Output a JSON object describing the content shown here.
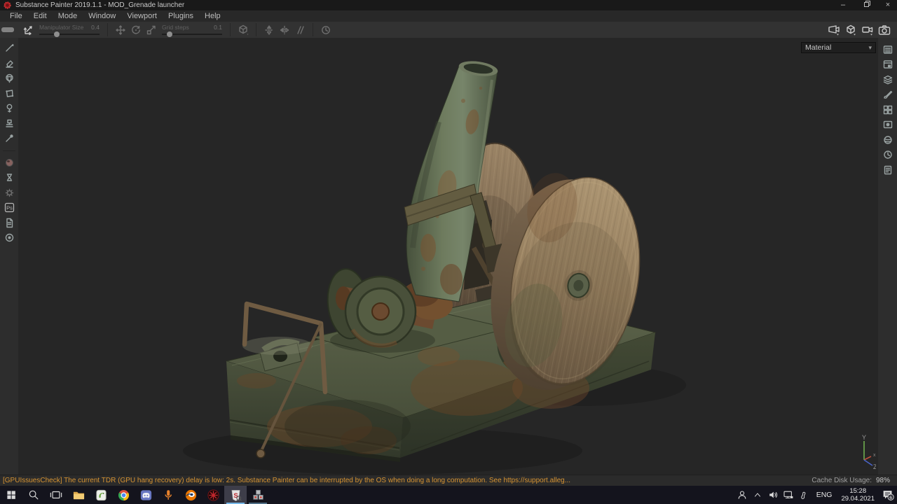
{
  "window": {
    "title": "Substance Painter 2019.1.1 - MOD_Grenade launcher",
    "controls": {
      "minimize": "–",
      "close": "×"
    }
  },
  "menu": {
    "items": [
      "File",
      "Edit",
      "Mode",
      "Window",
      "Viewport",
      "Plugins",
      "Help"
    ]
  },
  "toolbar": {
    "manipulator_label": "Manipulator Size",
    "manipulator_value": "0.4",
    "grid_label": "Grid steps",
    "grid_value": "0.1"
  },
  "viewport": {
    "shading_dropdown": "Material",
    "gizmo": {
      "y": "Y",
      "x": "x",
      "z": "Z"
    },
    "model_subject": "rusty green trench mortar with wooden wheels"
  },
  "left_toolbar": {
    "tools": [
      "paint",
      "eraser",
      "projection",
      "polygon-fill",
      "smudge",
      "clone",
      "material-picker"
    ],
    "plugins": [
      "sphere-plugin",
      "hourglass-plugin",
      "gear-plugin",
      "photoshop-export",
      "document-plugin",
      "circle-plugin"
    ]
  },
  "right_dock": {
    "panels": [
      "texture-set-list",
      "texture-set-settings",
      "layers",
      "properties",
      "shelf",
      "display-settings",
      "shader-settings",
      "history",
      "log"
    ]
  },
  "icons": {
    "chevron_down": "▾",
    "ps_badge": "Ps",
    "sp_letter": "S"
  },
  "status_bar": {
    "message": "[GPUIssuesCheck] The current TDR (GPU hang recovery) delay is low: 2s. Substance Painter can be interrupted by the OS when doing a long computation. See https://support.alleg...",
    "cache_label": "Cache Disk Usage:",
    "cache_value": "98%"
  },
  "taskbar": {
    "apps": [
      "start",
      "search",
      "task-view",
      "file-explorer",
      "notepad-plus-plus",
      "chrome",
      "discord",
      "voice-app",
      "blender",
      "red-target-app",
      "substance-painter",
      "uv-blocks-app"
    ],
    "active_app": "substance-painter",
    "tray": {
      "language": "ENG",
      "time": "15:28",
      "date": "29.04.2021",
      "notification_badge": "6"
    }
  },
  "colors": {
    "accent_underline": "#76b8e8",
    "status_warning": "#d79433",
    "viewport_bg": "#262626",
    "taskbar_bg": "#14141d"
  }
}
